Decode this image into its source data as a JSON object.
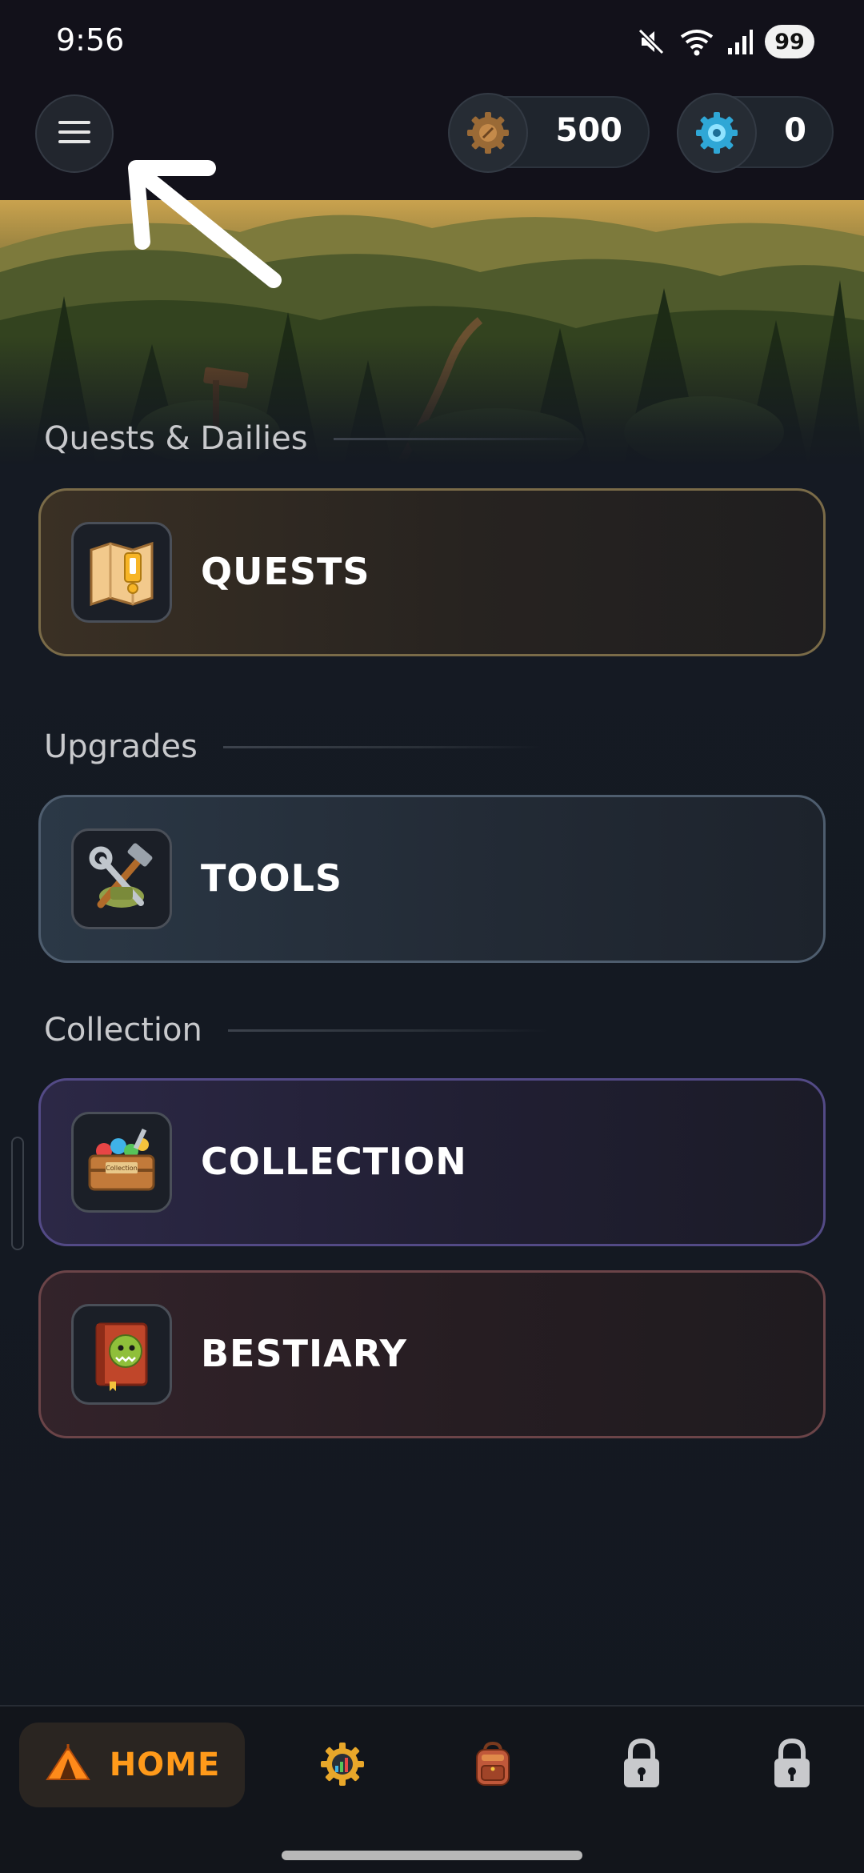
{
  "status_bar": {
    "time": "9:56",
    "battery": "99"
  },
  "header": {
    "menu_icon": "hamburger-menu-icon",
    "gold": {
      "icon": "wooden-gear-coin-icon",
      "value": "500"
    },
    "gems": {
      "icon": "blue-gear-gem-icon",
      "value": "0"
    }
  },
  "overlay": {
    "arrow_icon": "tutorial-arrow-icon"
  },
  "sections": {
    "quests": {
      "title": "Quests & Dailies",
      "card": {
        "label": "QUESTS",
        "icon": "quest-map-icon"
      }
    },
    "upgrades": {
      "title": "Upgrades",
      "card": {
        "label": "TOOLS",
        "icon": "hammer-wrench-icon"
      }
    },
    "collection": {
      "title": "Collection",
      "cards": [
        {
          "label": "COLLECTION",
          "icon": "treasure-chest-icon",
          "chest_text": "Collection"
        },
        {
          "label": "BESTIARY",
          "icon": "monster-book-icon"
        }
      ]
    }
  },
  "bottom_nav": {
    "home": {
      "label": "HOME",
      "icon": "tent-icon",
      "active": true
    },
    "items": [
      {
        "icon": "upgrades-gear-icon"
      },
      {
        "icon": "backpack-icon"
      },
      {
        "icon": "lock-icon",
        "locked": true
      },
      {
        "icon": "lock-icon",
        "locked": true
      }
    ]
  },
  "colors": {
    "accent": "#ff9a1a",
    "background": "#151a22",
    "quests_border": "#7a6b48",
    "tools_border": "#4e5d6e",
    "collection_border": "#534a86",
    "bestiary_border": "#6b4448"
  }
}
